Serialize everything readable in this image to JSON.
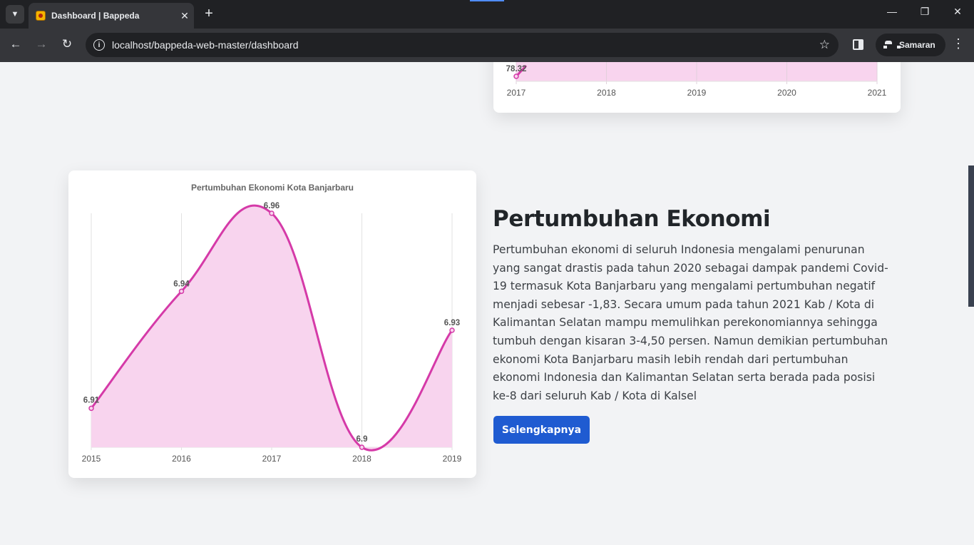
{
  "browser": {
    "tab_title": "Dashboard | Bappeda",
    "url": "localhost/bappeda-web-master/dashboard",
    "profile_label": "Samaran"
  },
  "top_chart": {
    "chart_data": {
      "type": "area",
      "x": [
        "2017",
        "2018",
        "2019",
        "2020",
        "2021"
      ],
      "visible_labels": [
        {
          "x": "2017",
          "value": "78.32"
        }
      ]
    }
  },
  "main_chart": {
    "chart_data": {
      "type": "area",
      "title": "Pertumbuhan Ekonomi Kota Banjarbaru",
      "categories": [
        "2015",
        "2016",
        "2017",
        "2018",
        "2019"
      ],
      "values": [
        6.91,
        6.94,
        6.96,
        6.9,
        6.93
      ],
      "labels": [
        "6.91",
        "6.94",
        "6.96",
        "6.9",
        "6.93"
      ],
      "ylim": [
        6.9,
        6.96
      ],
      "line_color": "#d53aa8",
      "fill_color": "#f8d4ee",
      "grid": "vertical"
    }
  },
  "section": {
    "heading": "Pertumbuhan Ekonomi",
    "body": "Pertumbuhan ekonomi di seluruh Indonesia mengalami penurunan yang sangat drastis pada tahun 2020 sebagai dampak pandemi Covid-19 termasuk Kota Banjarbaru yang mengalami pertumbuhan negatif menjadi sebesar -1,83. Secara umum pada tahun 2021 Kab / Kota di Kalimantan Selatan mampu memulihkan perekonomiannya sehingga tumbuh dengan kisaran 3-4,50 persen. Namun demikian pertumbuhan ekonomi Kota Banjarbaru masih lebih rendah dari pertumbuhan ekonomi Indonesia dan Kalimantan Selatan serta berada pada posisi ke-8 dari seluruh Kab / Kota di Kalsel",
    "button_label": "Selengkapnya",
    "button_color": "#1f5bd1"
  }
}
